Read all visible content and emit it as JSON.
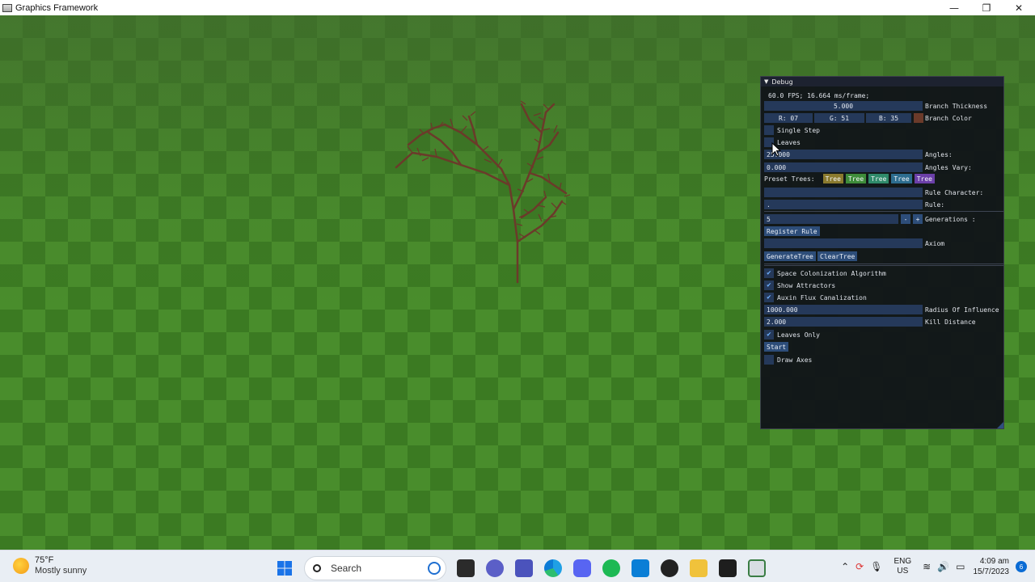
{
  "window": {
    "title": "Graphics Framework",
    "minimize": "—",
    "maximize": "❐",
    "close": "✕"
  },
  "debug": {
    "header": "Debug",
    "header_arrow": "▼",
    "fps_text": "60.0 FPS;  16.664 ms/frame;",
    "branch_thickness_value": "5.000",
    "branch_thickness_label": "Branch Thickness",
    "color_r": "R: 07",
    "color_g": "G: 51",
    "color_b": "B: 35",
    "branch_color_label": "Branch Color",
    "branch_color_swatch": "#6b3a2a",
    "single_step_label": "Single Step",
    "leaves_label": "Leaves",
    "angles_value": "25.000",
    "angles_label": "Angles:",
    "angles_vary_value": "0.000",
    "angles_vary_label": "Angles Vary:",
    "preset_trees_label": "Preset Trees:",
    "presets": [
      {
        "label": "Tree",
        "color": "#8a7a2e"
      },
      {
        "label": "Tree",
        "color": "#3e8c3a"
      },
      {
        "label": "Tree",
        "color": "#2f8a6a"
      },
      {
        "label": "Tree",
        "color": "#2d6d8f"
      },
      {
        "label": "Tree",
        "color": "#6b3fa8"
      }
    ],
    "rule_character_label": "Rule Character:",
    "rule_label": "Rule:",
    "rule_value": ".",
    "generations_value": "5",
    "generations_minus": "-",
    "generations_plus": "+",
    "generations_label": "Generations :",
    "register_rule_label": "Register Rule",
    "axiom_label": "Axiom",
    "generate_tree_label": "GenerateTree",
    "clear_tree_label": "ClearTree",
    "space_colonization_label": "Space Colonization Algorithm",
    "show_attractors_label": "Show Attractors",
    "auxin_flux_label": "Auxin Flux Canalization",
    "radius_value": "1000.000",
    "radius_label": "Radius Of Influence",
    "kill_distance_value": "2.000",
    "kill_distance_label": "Kill Distance",
    "leaves_only_label": "Leaves Only",
    "start_label": "Start",
    "draw_axes_label": "Draw Axes",
    "checkmark": "✔"
  },
  "taskbar": {
    "temperature": "75°F",
    "condition": "Mostly sunny",
    "search_placeholder": "Search",
    "language_line1": "ENG",
    "language_line2": "US",
    "time": "4:09 am",
    "date": "15/7/2023",
    "notification_count": "6"
  },
  "colors": {
    "panel_bg": "#101218",
    "field_bg": "#25395a",
    "button_bg": "#2d4d79",
    "tree_branch": "#6b3a2a",
    "ground_dark": "#3b7a22",
    "ground_light": "#498d2c"
  }
}
